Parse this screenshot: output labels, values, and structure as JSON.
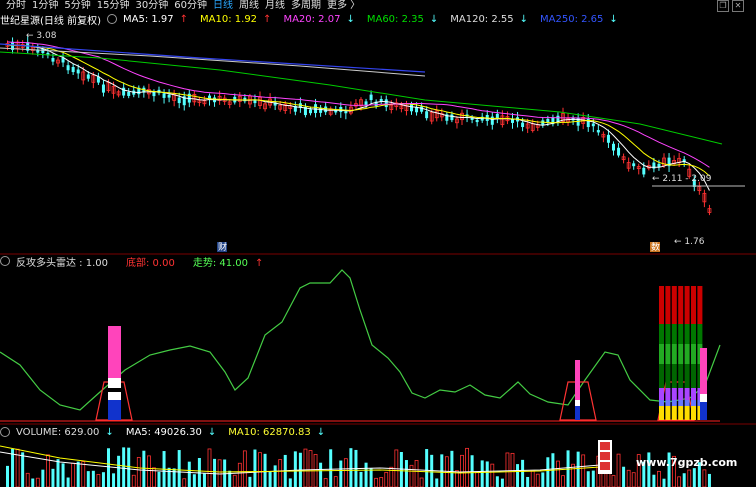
{
  "toolbar": {
    "items": [
      "分时",
      "1分钟",
      "5分钟",
      "15分钟",
      "30分钟",
      "60分钟",
      "日线",
      "周线",
      "月线",
      "多周期",
      "更多"
    ],
    "more_suffix": "〉",
    "active": "日线"
  },
  "main": {
    "title": "世纪星源(日线 前复权)",
    "ma": [
      {
        "label": "MA5: 1.97",
        "arrow": "↑",
        "color": "#ffffff"
      },
      {
        "label": "MA10: 1.92",
        "arrow": "↑",
        "color": "#ffff00"
      },
      {
        "label": "MA20: 2.07",
        "arrow": "↓",
        "color": "#ff44ff"
      },
      {
        "label": "MA60: 2.35",
        "arrow": "↓",
        "color": "#00dd00"
      },
      {
        "label": "MA120: 2.55",
        "arrow": "↓",
        "color": "#dddddd"
      },
      {
        "label": "MA250: 2.65",
        "arrow": "↓",
        "color": "#3355ff"
      }
    ],
    "high_label": "3.08",
    "low_label": "1.76",
    "range_label": "2.11 - 2.09",
    "cai_label": "财",
    "shu_label": "数"
  },
  "indicator": {
    "name": "反攻多头雷达 : 1.00",
    "bottom": "底部: 0.00",
    "trend": "走势: 41.00",
    "trend_arrow": "↑"
  },
  "volume": {
    "vol": "VOLUME: 629.00",
    "vol_arrow": "↓",
    "ma5": "MA5: 49026.30",
    "ma5_arrow": "↓",
    "ma10": "MA10: 62870.83",
    "ma10_arrow": "↓"
  },
  "watermark": "www.7gpzb.com",
  "colors": {
    "up": "#ff3232",
    "down": "#54ffff",
    "bg": "#000000"
  }
}
